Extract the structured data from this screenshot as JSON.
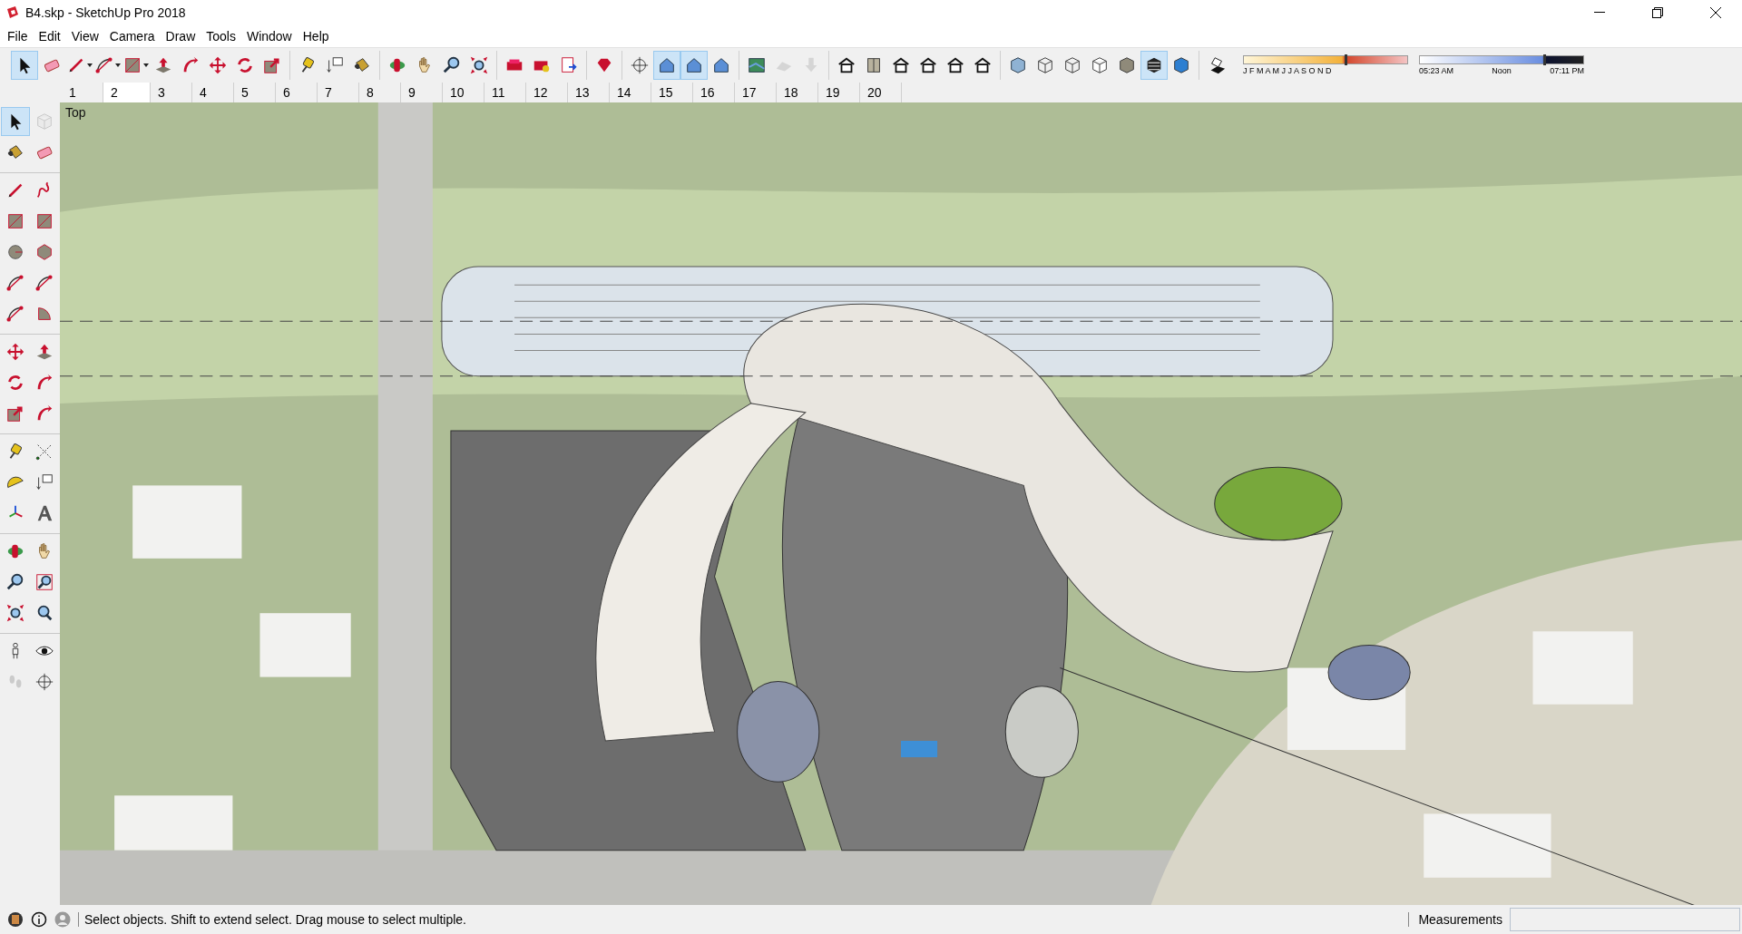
{
  "window": {
    "title": "B4.skp - SketchUp Pro 2018"
  },
  "menu": [
    "File",
    "Edit",
    "View",
    "Camera",
    "Draw",
    "Tools",
    "Window",
    "Help"
  ],
  "toolbar": {
    "groups": [
      [
        {
          "kind": "select",
          "selected": true,
          "disabled": false
        },
        {
          "kind": "eraser",
          "selected": false,
          "disabled": false
        },
        {
          "kind": "pencil-menu",
          "selected": false,
          "disabled": false
        },
        {
          "kind": "arc-menu",
          "selected": false,
          "disabled": false
        },
        {
          "kind": "rect-menu",
          "selected": false,
          "disabled": false
        },
        {
          "kind": "pushpull",
          "selected": false,
          "disabled": false
        },
        {
          "kind": "followme",
          "selected": false,
          "disabled": false
        },
        {
          "kind": "move",
          "selected": false,
          "disabled": false
        },
        {
          "kind": "rotate",
          "selected": false,
          "disabled": false
        },
        {
          "kind": "scale",
          "selected": false,
          "disabled": false
        }
      ],
      [
        {
          "kind": "tape",
          "selected": false,
          "disabled": false
        },
        {
          "kind": "text",
          "selected": false,
          "disabled": false
        },
        {
          "kind": "paint",
          "selected": false,
          "disabled": false
        }
      ],
      [
        {
          "kind": "orbit",
          "selected": false,
          "disabled": false
        },
        {
          "kind": "pan",
          "selected": false,
          "disabled": false
        },
        {
          "kind": "zoom",
          "selected": false,
          "disabled": false
        },
        {
          "kind": "zoomext",
          "selected": false,
          "disabled": false
        }
      ],
      [
        {
          "kind": "warehouse",
          "selected": false,
          "disabled": false
        },
        {
          "kind": "extension",
          "selected": false,
          "disabled": false
        },
        {
          "kind": "layout",
          "selected": false,
          "disabled": false
        }
      ],
      [
        {
          "kind": "ruby",
          "selected": false,
          "disabled": false
        }
      ],
      [
        {
          "kind": "crosshair",
          "selected": false,
          "disabled": false
        },
        {
          "kind": "section",
          "selected": true,
          "disabled": false
        },
        {
          "kind": "section",
          "selected": true,
          "disabled": false
        },
        {
          "kind": "section",
          "selected": false,
          "disabled": false
        }
      ],
      [
        {
          "kind": "map",
          "selected": false,
          "disabled": false
        },
        {
          "kind": "terrain",
          "selected": false,
          "disabled": true
        },
        {
          "kind": "import",
          "selected": false,
          "disabled": true
        }
      ],
      [
        {
          "kind": "house",
          "selected": false,
          "disabled": false
        },
        {
          "kind": "door",
          "selected": false,
          "disabled": false
        },
        {
          "kind": "house",
          "selected": false,
          "disabled": false
        },
        {
          "kind": "house",
          "selected": false,
          "disabled": false
        },
        {
          "kind": "house",
          "selected": false,
          "disabled": false
        },
        {
          "kind": "house",
          "selected": false,
          "disabled": false
        }
      ],
      [
        {
          "kind": "xray",
          "selected": false,
          "disabled": false
        },
        {
          "kind": "wire",
          "selected": false,
          "disabled": false
        },
        {
          "kind": "wire",
          "selected": false,
          "disabled": false
        },
        {
          "kind": "hidden",
          "selected": false,
          "disabled": false
        },
        {
          "kind": "shaded",
          "selected": false,
          "disabled": false
        },
        {
          "kind": "textured",
          "selected": true,
          "disabled": false
        },
        {
          "kind": "mono",
          "selected": false,
          "disabled": false
        }
      ],
      [
        {
          "kind": "shadow",
          "selected": false,
          "disabled": false
        }
      ]
    ]
  },
  "shadow_settings": {
    "date_slider": {
      "months": "J F M A M J J A S O N D",
      "level": 0.62
    },
    "time_slider": {
      "times": [
        "05:23 AM",
        "Noon",
        "07:11 PM"
      ],
      "level": 0.76
    }
  },
  "scene_tabs": [
    {
      "label": "1",
      "selected": false
    },
    {
      "label": "2",
      "selected": true
    },
    {
      "label": "3",
      "selected": false
    },
    {
      "label": "4",
      "selected": false
    },
    {
      "label": "5",
      "selected": false
    },
    {
      "label": "6",
      "selected": false
    },
    {
      "label": "7",
      "selected": false
    },
    {
      "label": "8",
      "selected": false
    },
    {
      "label": "9",
      "selected": false
    },
    {
      "label": "10",
      "selected": false
    },
    {
      "label": "11",
      "selected": false
    },
    {
      "label": "12",
      "selected": false
    },
    {
      "label": "13",
      "selected": false
    },
    {
      "label": "14",
      "selected": false
    },
    {
      "label": "15",
      "selected": false
    },
    {
      "label": "16",
      "selected": false
    },
    {
      "label": "17",
      "selected": false
    },
    {
      "label": "18",
      "selected": false
    },
    {
      "label": "19",
      "selected": false
    },
    {
      "label": "20",
      "selected": false
    }
  ],
  "side_toolbar": {
    "groups": [
      [
        {
          "kind": "select",
          "selected": true,
          "disabled": false
        },
        {
          "kind": "component",
          "selected": false,
          "disabled": true
        },
        {
          "kind": "paint",
          "selected": false,
          "disabled": false
        },
        {
          "kind": "eraser",
          "selected": false,
          "disabled": false
        }
      ],
      [
        {
          "kind": "pencil",
          "selected": false,
          "disabled": false
        },
        {
          "kind": "freehand",
          "selected": false,
          "disabled": false
        },
        {
          "kind": "rect",
          "selected": false,
          "disabled": false
        },
        {
          "kind": "rect",
          "selected": false,
          "disabled": false
        },
        {
          "kind": "circle",
          "selected": false,
          "disabled": false
        },
        {
          "kind": "polygon",
          "selected": false,
          "disabled": false
        },
        {
          "kind": "arc",
          "selected": false,
          "disabled": false
        },
        {
          "kind": "arc",
          "selected": false,
          "disabled": false
        },
        {
          "kind": "arc",
          "selected": false,
          "disabled": false
        },
        {
          "kind": "pie",
          "selected": false,
          "disabled": false
        }
      ],
      [
        {
          "kind": "move",
          "selected": false,
          "disabled": false
        },
        {
          "kind": "pushpull",
          "selected": false,
          "disabled": false
        },
        {
          "kind": "rotate",
          "selected": false,
          "disabled": false
        },
        {
          "kind": "followme",
          "selected": false,
          "disabled": false
        },
        {
          "kind": "scale",
          "selected": false,
          "disabled": false
        },
        {
          "kind": "followme",
          "selected": false,
          "disabled": false
        }
      ],
      [
        {
          "kind": "tape",
          "selected": false,
          "disabled": false
        },
        {
          "kind": "dimension",
          "selected": false,
          "disabled": false
        },
        {
          "kind": "protractor",
          "selected": false,
          "disabled": false
        },
        {
          "kind": "text",
          "selected": false,
          "disabled": false
        },
        {
          "kind": "axes",
          "selected": false,
          "disabled": false
        },
        {
          "kind": "text3d",
          "selected": false,
          "disabled": false
        }
      ],
      [
        {
          "kind": "orbit",
          "selected": false,
          "disabled": false
        },
        {
          "kind": "pan",
          "selected": false,
          "disabled": false
        },
        {
          "kind": "zoom",
          "selected": false,
          "disabled": false
        },
        {
          "kind": "zoomwin",
          "selected": false,
          "disabled": false
        },
        {
          "kind": "zoomext",
          "selected": false,
          "disabled": false
        },
        {
          "kind": "previous",
          "selected": false,
          "disabled": false
        }
      ],
      [
        {
          "kind": "person",
          "selected": false,
          "disabled": false
        },
        {
          "kind": "eye",
          "selected": false,
          "disabled": false
        },
        {
          "kind": "walk",
          "selected": false,
          "disabled": true
        },
        {
          "kind": "crosshair",
          "selected": false,
          "disabled": false
        }
      ]
    ]
  },
  "viewport": {
    "view_label": "Top"
  },
  "status_bar": {
    "message": "Select objects. Shift to extend select. Drag mouse to select multiple.",
    "measurements_label": "Measurements"
  }
}
